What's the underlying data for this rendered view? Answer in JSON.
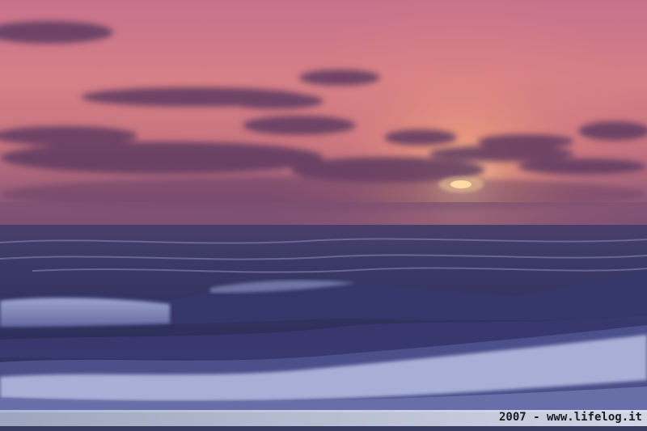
{
  "photo": {
    "subject": "sunset over sea waves",
    "watermark": "2007 - www.lifelog.it"
  },
  "colors": {
    "sky_top": "#c86a8a",
    "sky_glow": "#f2a07a",
    "sun": "#ffd7a0",
    "cloud": "#5a3a5e",
    "sea_far": "#3b3a66",
    "sea_near": "#2b2d55",
    "foam": "#cfd7f3"
  }
}
